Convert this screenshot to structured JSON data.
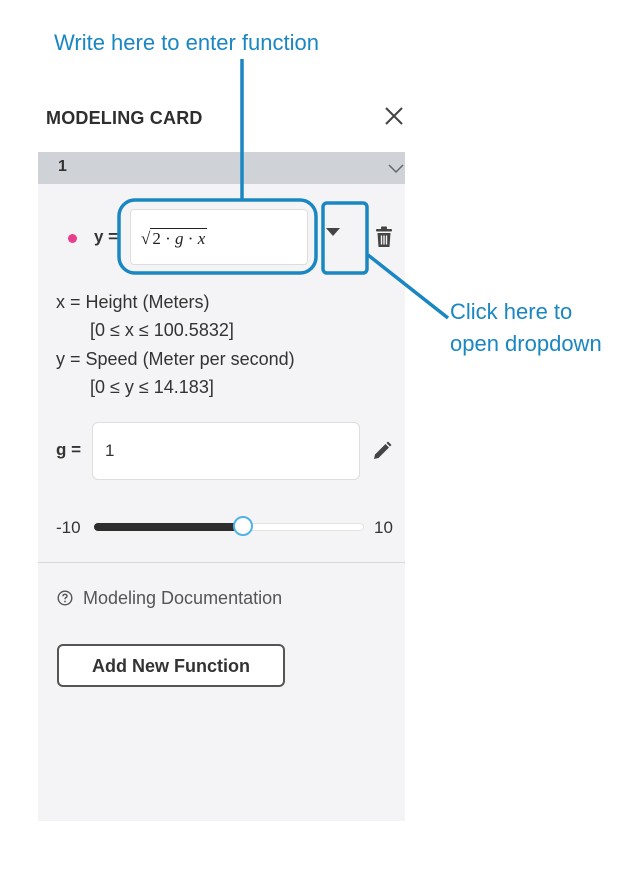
{
  "annotations": {
    "top": "Write here to enter function",
    "right_line1": "Click here to",
    "right_line2": "open dropdown"
  },
  "card": {
    "title": "MODELING CARD",
    "section_number": "1",
    "function": {
      "lhs": "y =",
      "rhs_number": "2",
      "rhs_dot1": "·",
      "rhs_var_g": "g",
      "rhs_dot2": "·",
      "rhs_var_x": "x",
      "dot_color": "#e83e8c"
    },
    "info": {
      "x_desc": "x = Height (Meters)",
      "x_range": "[0 ≤ x ≤ 100.5832]",
      "y_desc": "y = Speed (Meter per second)",
      "y_range": "[0 ≤ y ≤ 14.183]"
    },
    "param": {
      "label": "g =",
      "value": "1"
    },
    "slider": {
      "min": "-10",
      "max": "10",
      "value_fraction": 0.55
    },
    "doc_link": "Modeling Documentation",
    "add_button": "Add New Function"
  },
  "colors": {
    "annotation": "#1a86c2",
    "slider_thumb": "#4fb3e8",
    "section_bar": "#cfd3d8"
  },
  "icons": [
    "close-icon",
    "chevron-down-icon",
    "dropdown-arrow-icon",
    "trash-icon",
    "pencil-icon",
    "help-circle-icon"
  ]
}
